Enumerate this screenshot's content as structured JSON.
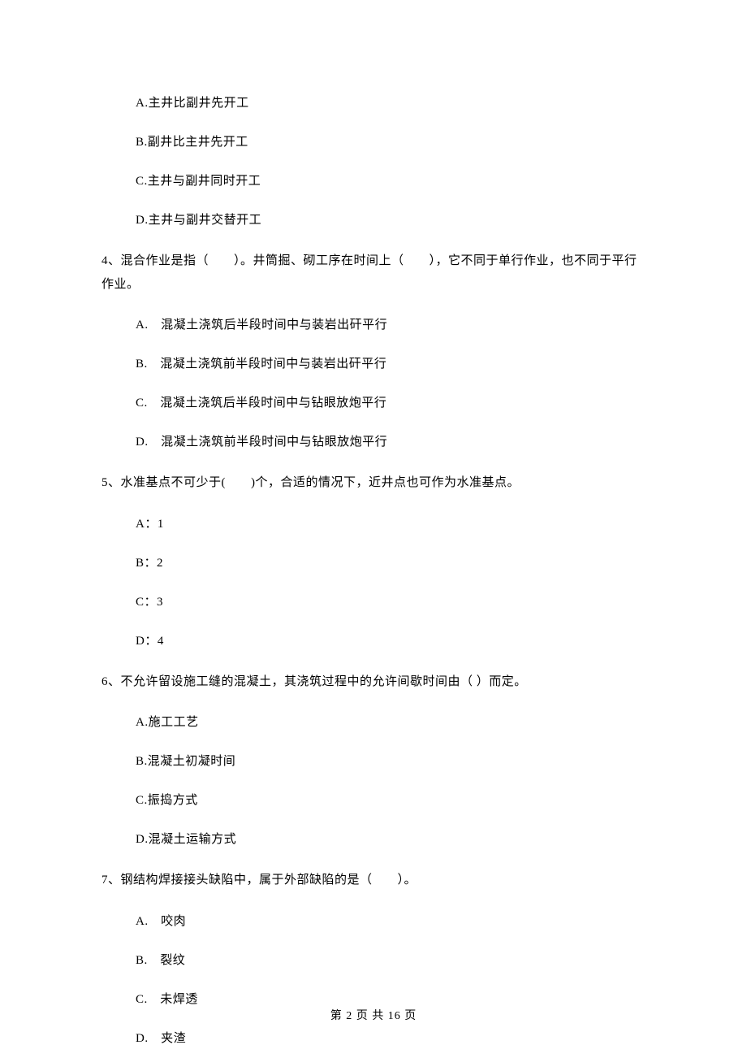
{
  "q3": {
    "optionA": "A.主井比副井先开工",
    "optionB": "B.副井比主井先开工",
    "optionC": "C.主井与副井同时开工",
    "optionD": "D.主井与副井交替开工"
  },
  "q4": {
    "text": "4、混合作业是指（　　）。井筒掘、砌工序在时间上（　　），它不同于单行作业，也不同于平行作业。",
    "optionA": "A.　混凝土浇筑后半段时间中与装岩出矸平行",
    "optionB": "B.　混凝土浇筑前半段时间中与装岩出矸平行",
    "optionC": "C.　混凝土浇筑后半段时间中与钻眼放炮平行",
    "optionD": "D.　混凝土浇筑前半段时间中与钻眼放炮平行"
  },
  "q5": {
    "text": "5、水准基点不可少于(　　)个，合适的情况下，近井点也可作为水准基点。",
    "optionA": "A：1",
    "optionB": "B：2",
    "optionC": "C：3",
    "optionD": "D：4"
  },
  "q6": {
    "text": "6、不允许留设施工缝的混凝土，其浇筑过程中的允许间歇时间由（ ）而定。",
    "optionA": "A.施工工艺",
    "optionB": "B.混凝土初凝时间",
    "optionC": "C.振捣方式",
    "optionD": "D.混凝土运输方式"
  },
  "q7": {
    "text": "7、钢结构焊接接头缺陷中，属于外部缺陷的是（　　）。",
    "optionA": "A.　咬肉",
    "optionB": "B.　裂纹",
    "optionC": "C.　未焊透",
    "optionD": "D.　夹渣"
  },
  "footer": "第 2 页 共 16 页"
}
